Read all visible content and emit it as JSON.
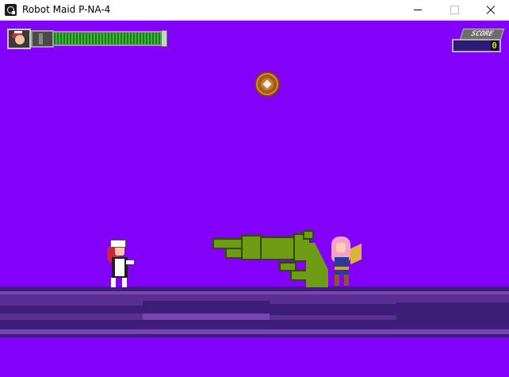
{
  "window": {
    "title": "Robot Maid P-NA-4",
    "icons": {
      "app": "app-icon",
      "minimize": "minimize-icon",
      "maximize": "maximize-icon",
      "close": "close-icon"
    }
  },
  "game": {
    "background_color": "#8300fa",
    "hud": {
      "health_fraction": 1.0,
      "score_label": "SCORE",
      "score_value": "0"
    },
    "ground_colors": [
      "#3d1f7a",
      "#5a2f94",
      "#7a45b0"
    ],
    "entities": [
      "player-maid",
      "boss-girl",
      "giant-cannon-arm",
      "bronze-coin"
    ]
  }
}
